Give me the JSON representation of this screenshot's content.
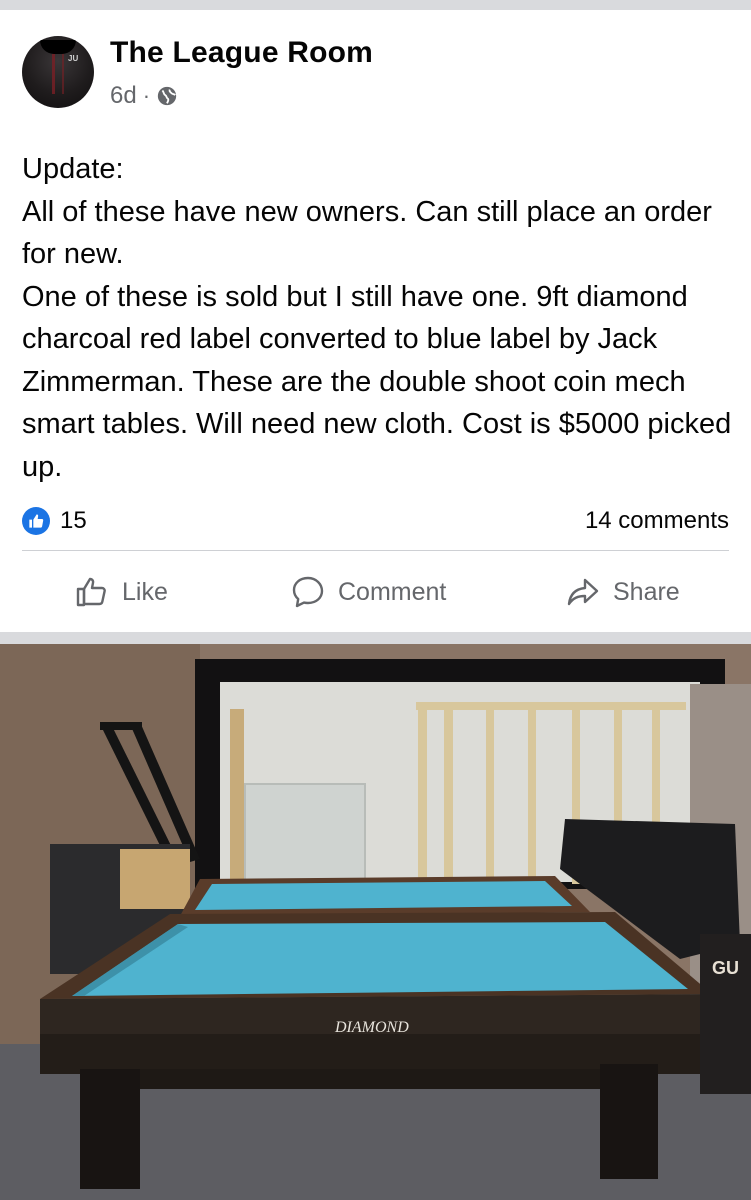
{
  "post": {
    "author": "The League Room",
    "time": "6d",
    "separator": "·",
    "visibility_icon": "globe-icon",
    "avatar_text": "JU",
    "text": {
      "line1": "Update:",
      "line2": "All of these have new owners. Can still place an order for new.",
      "line3": "One of these is sold but I still have one. 9ft diamond charcoal red label converted to blue label by Jack Zimmerman. These are the double shoot coin mech smart tables. Will need new cloth. Cost is $5000 picked up."
    }
  },
  "engagement": {
    "reaction_icon": "like-reaction-icon",
    "reaction_count": "15",
    "comments": "14 comments"
  },
  "actions": {
    "like": "Like",
    "comment": "Comment",
    "share": "Share"
  },
  "photo": {
    "table_brand": "DIAMOND",
    "box_text": "GU"
  },
  "colors": {
    "accent_blue": "#1b74e4",
    "muted_text": "#65676b",
    "divider": "#d9dadd",
    "felt": "#4fb3cf"
  }
}
